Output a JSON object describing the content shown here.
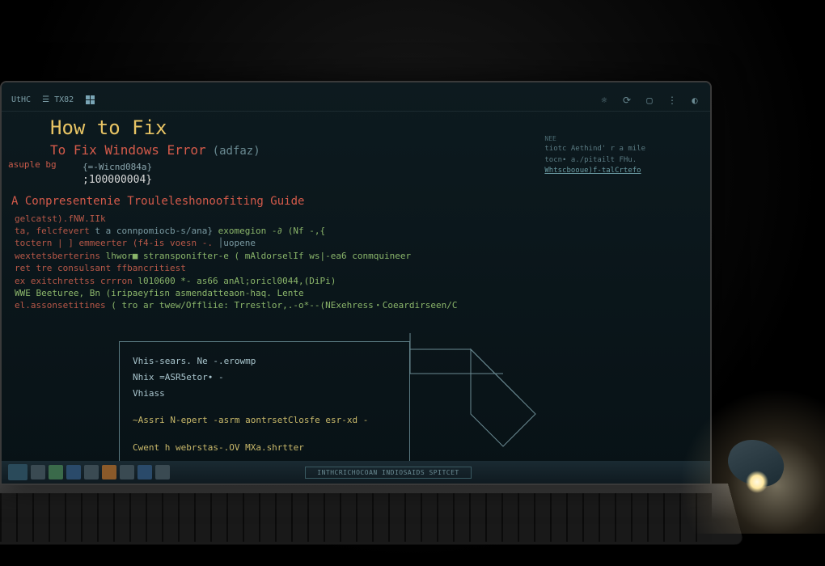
{
  "topbar": {
    "left_items": [
      "UtHC",
      "TX82"
    ],
    "win_icon": "windows-icon"
  },
  "title": {
    "main": "How to Fix",
    "sub_red": "To Fix Windows Error",
    "sub_suffix": "(adfaz)"
  },
  "code_fragment": {
    "brace_line": "{=-Wicnd084a}",
    "num_line": ";100000004}"
  },
  "side_label": "asuple bg",
  "guide_title": "A Conpresentenie Trouleleshonoofiting Guide",
  "decl_lines": [
    {
      "head": "gelcatst).fNW.IIk",
      "body": ""
    },
    {
      "head": "ta, felcfevert",
      "mid": "t a connpomiocb-s/ana}",
      "tail": "exomegion -∂   (Nf -,{"
    },
    {
      "head": "toсtern | ] emmeerter (f4-is voesn -.",
      "body": "│uopene"
    },
    {
      "head": "wextetsberterins",
      "mid": "lhwor■ stransponifter-e (",
      "tail": "mAldorselIf ws|-ea6 conmquineer"
    },
    {
      "head": "ret tre consulsant ffbancritiest",
      "body": ""
    },
    {
      "head": "ex exitchrettss crrron",
      "mid": "l010600 *- as66 anAl;oricl0044,(DiPi)",
      "tail": ""
    },
    {
      "head": "",
      "mid": "WWE Beeturee, Bn (iripaeyfisn asmendatteaon-haq. Lente",
      "tail": ""
    },
    {
      "head": "el.assonsetitines",
      "mid": "( tro ar twew/Offliie: Trrestlor,.-o*--(NExehress・Coeardirseen/C",
      "tail": ""
    }
  ],
  "terminal": {
    "l1": "Vhis-sears. Ne -.erowmp",
    "l2": "Nhix  =ASR5etor∙ -",
    "l3": "Vhiass",
    "l4": "~Assri N-epert  -asrm  aontrsetClosfe  esr-xd -",
    "l5": "Cwent h webrstas-.OV  MXa.shrtter"
  },
  "right_info": {
    "l1": "tiotc   Aethind' r a mile",
    "l2": "tocn∙ a./pitailt  FHu.",
    "l3": "Whtscbooue)f-talCrtefo"
  },
  "right_label": "NEE",
  "taskbar_widget": "INTHCRICHOCOAN INDIOSAIDS SPITCET"
}
